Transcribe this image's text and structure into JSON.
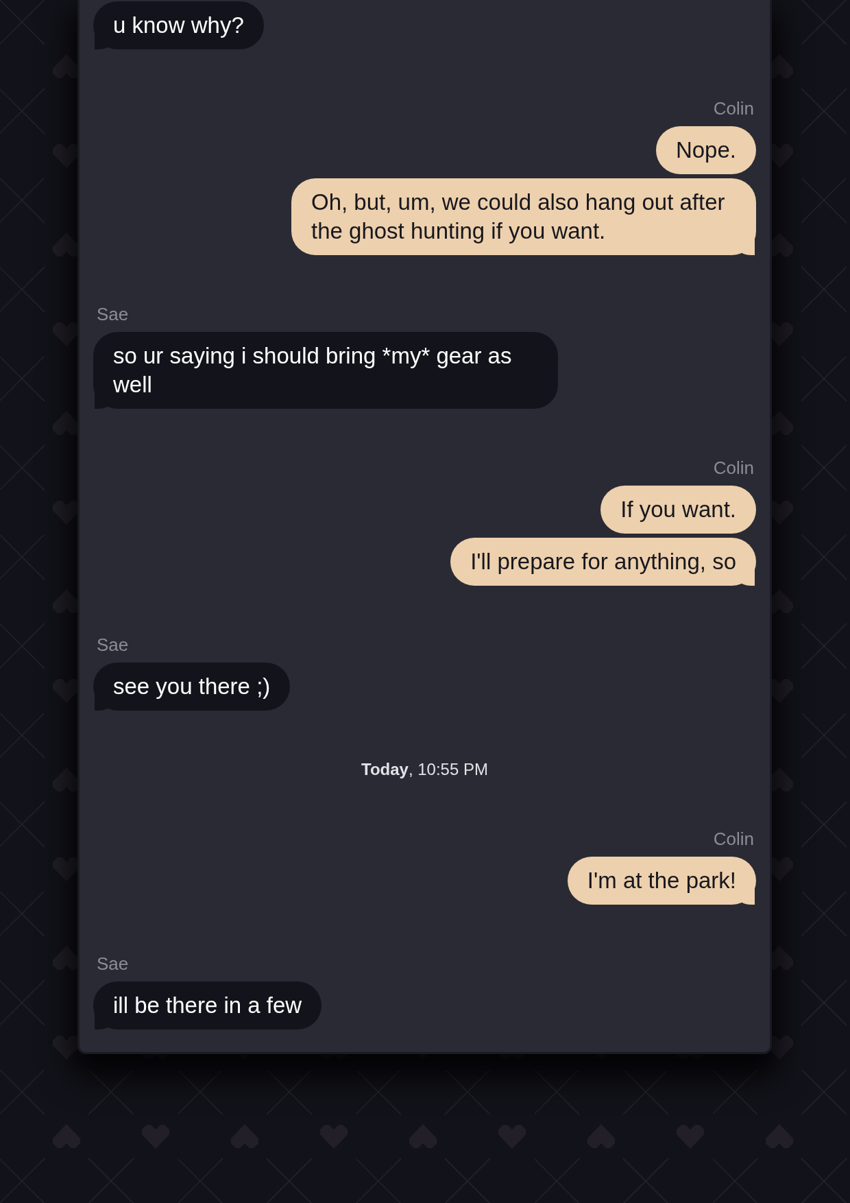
{
  "chat": {
    "thread": [
      {
        "kind": "incoming",
        "messages": [
          "u know why?"
        ]
      },
      {
        "kind": "outgoing",
        "sender": "Colin",
        "messages": [
          "Nope.",
          "Oh, but, um, we could also hang out after the ghost hunting if you want."
        ]
      },
      {
        "kind": "incoming",
        "sender": "Sae",
        "messages": [
          "so ur saying i should bring *my* gear as well"
        ]
      },
      {
        "kind": "outgoing",
        "sender": "Colin",
        "messages": [
          "If you want.",
          "I'll prepare for anything, so"
        ]
      },
      {
        "kind": "incoming",
        "sender": "Sae",
        "messages": [
          "see you there ;)"
        ]
      },
      {
        "kind": "timestamp",
        "text": "**Today**, 10:55 PM"
      },
      {
        "kind": "outgoing",
        "sender": "Colin",
        "messages": [
          "I'm at the park!"
        ]
      },
      {
        "kind": "incoming",
        "sender": "Sae",
        "messages": [
          "ill be there in a few"
        ]
      }
    ]
  }
}
